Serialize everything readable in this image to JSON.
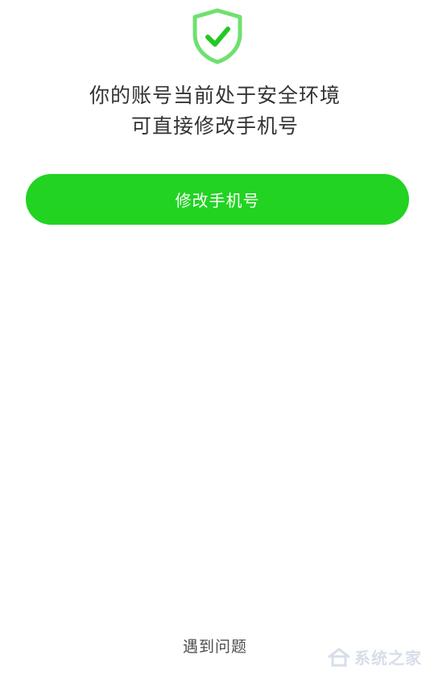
{
  "status": {
    "icon": "shield-check-icon",
    "line1": "你的账号当前处于安全环境",
    "line2": "可直接修改手机号"
  },
  "actions": {
    "change_phone_label": "修改手机号",
    "help_label": "遇到问题"
  },
  "watermark": {
    "text": "系统之家"
  },
  "colors": {
    "accent": "#22d322",
    "text": "#333333"
  }
}
